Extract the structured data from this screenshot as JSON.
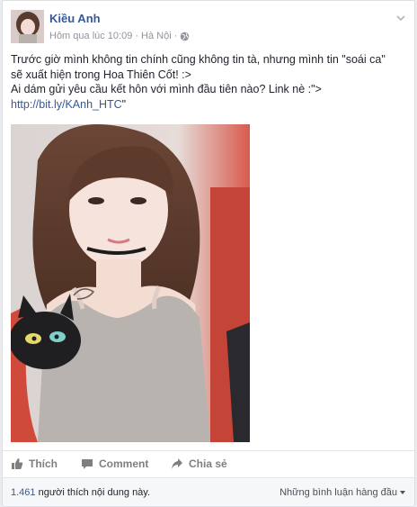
{
  "post": {
    "author": "Kiều Anh",
    "timestamp": "Hôm qua lúc 10:09",
    "separator": "·",
    "location": "Hà Nội",
    "separator2": "·",
    "text_lines": [
      "Trước giờ mình không tin chính cũng không tin tà, nhưng mình tin \"soái ca\"",
      "sẽ xuất hiện trong Hoa Thiên Cốt! :>",
      "Ai dám gửi yêu cầu kết hôn với mình đầu tiên nào? Link nè :\">"
    ],
    "link": "http://bit.ly/KAnh_HTC",
    "link_suffix": "\""
  },
  "actions": {
    "like": "Thích",
    "comment": "Comment",
    "share": "Chia sẻ"
  },
  "footer": {
    "likes_count": "1.461",
    "likes_text": " người thích nội dung này.",
    "sort_label": "Những bình luận hàng đầu"
  },
  "icons": {
    "globe": "globe-icon",
    "chevron": "chevron-down-icon",
    "like": "thumbs-up-icon",
    "comment": "speech-bubble-icon",
    "share": "share-arrow-icon"
  },
  "colors": {
    "link": "#365899",
    "meta": "#90949c",
    "action": "#7f7f7f"
  }
}
